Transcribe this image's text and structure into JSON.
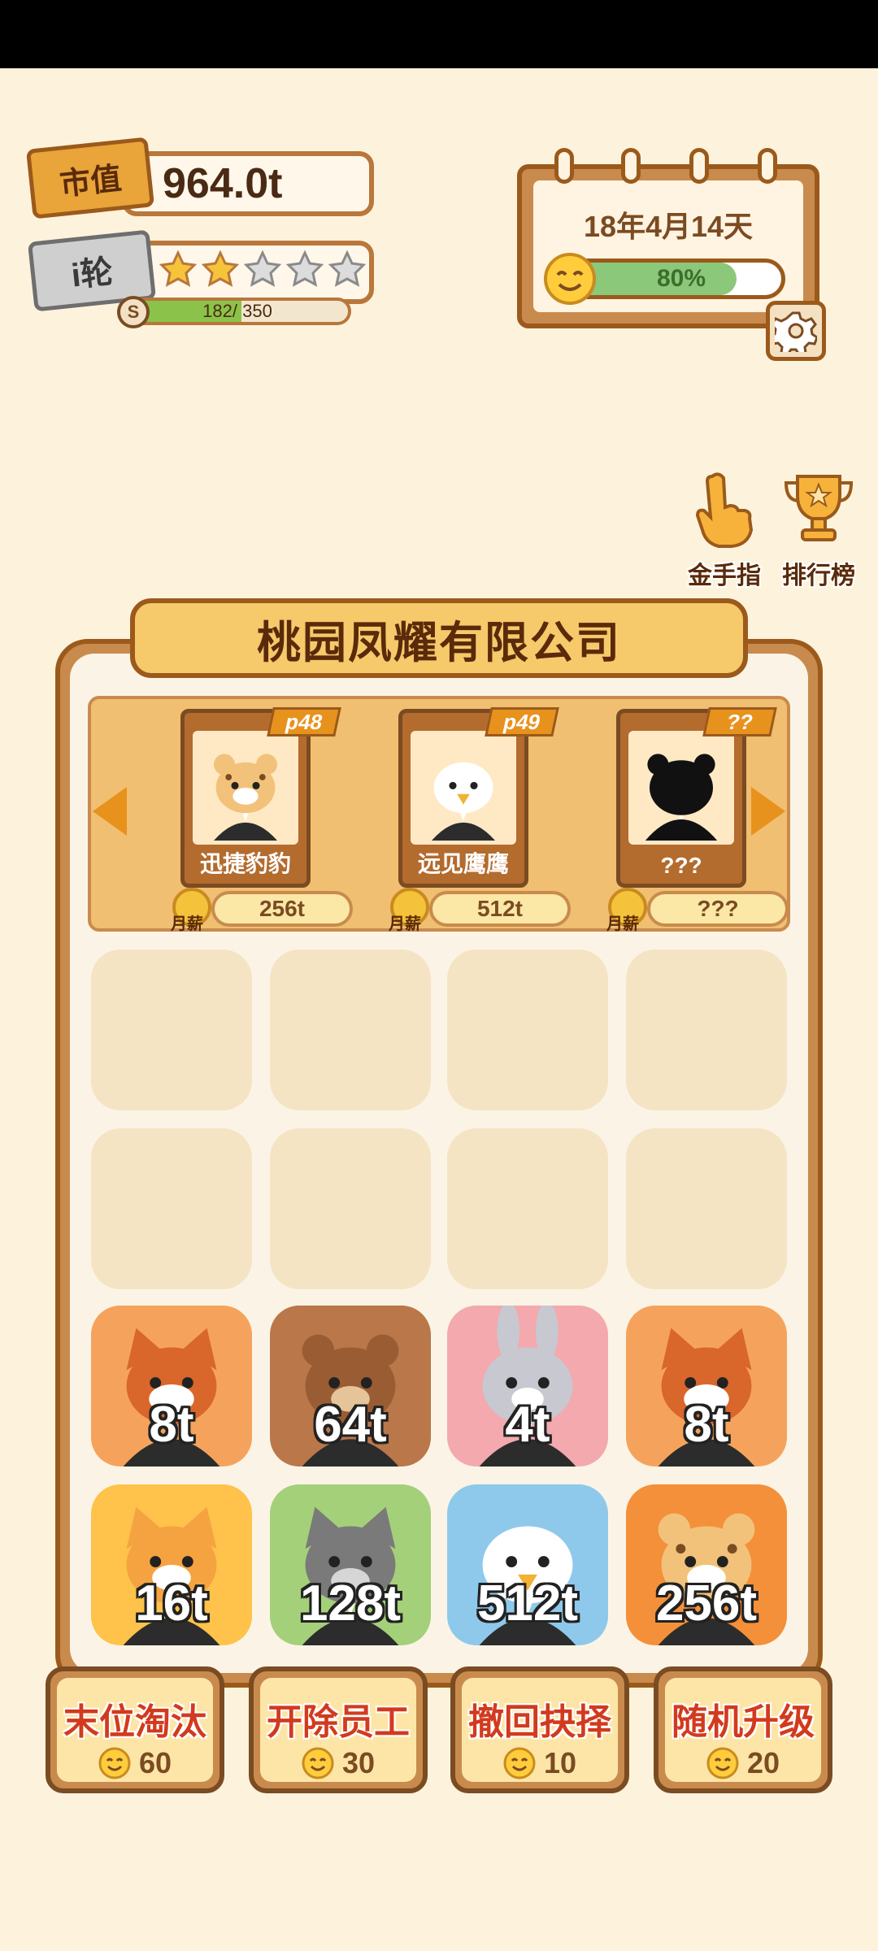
{
  "hud": {
    "market_value_tag": "市值",
    "market_value": "964.0t",
    "rank_tag": "i轮",
    "stars_filled": 2,
    "stars_total": 5,
    "xp_current": "182",
    "xp_max": "350",
    "xp_text": "182/ 350",
    "xp_fraction": 0.52,
    "xp_badge": "S"
  },
  "calendar": {
    "date": "18年4月14天",
    "mood_text": "80%",
    "mood_fraction": 0.8
  },
  "side_buttons": {
    "golden_finger": "金手指",
    "leaderboard": "排行榜"
  },
  "company": {
    "name": "桃园凤耀有限公司"
  },
  "roster": [
    {
      "level": "p48",
      "name": "迅捷豹豹",
      "salary": "256t",
      "salary_label": "月薪",
      "animal": "leopard"
    },
    {
      "level": "p49",
      "name": "远见鹰鹰",
      "salary": "512t",
      "salary_label": "月薪",
      "animal": "eagle"
    },
    {
      "level": "??",
      "name": "???",
      "salary": "???",
      "salary_label": "月薪",
      "animal": "unknown"
    }
  ],
  "grid": {
    "rows": [
      [
        null,
        null,
        null,
        null
      ],
      [
        null,
        null,
        null,
        null
      ],
      [
        {
          "value": "8t",
          "animal": "red-panda",
          "color": "#f5a35c"
        },
        {
          "value": "64t",
          "animal": "bear",
          "color": "#b9774a"
        },
        {
          "value": "4t",
          "animal": "rabbit",
          "color": "#f3a9ad"
        },
        {
          "value": "8t",
          "animal": "red-panda",
          "color": "#f5a35c"
        }
      ],
      [
        {
          "value": "16t",
          "animal": "cat",
          "color": "#ffc24a"
        },
        {
          "value": "128t",
          "animal": "wolf",
          "color": "#a4d07a"
        },
        {
          "value": "512t",
          "animal": "eagle",
          "color": "#8ec9ec"
        },
        {
          "value": "256t",
          "animal": "leopard",
          "color": "#f4903a"
        }
      ]
    ]
  },
  "actions": [
    {
      "label": "末位淘汰",
      "cost": "60"
    },
    {
      "label": "开除员工",
      "cost": "30"
    },
    {
      "label": "撤回抉择",
      "cost": "10"
    },
    {
      "label": "随机升级",
      "cost": "20"
    }
  ]
}
